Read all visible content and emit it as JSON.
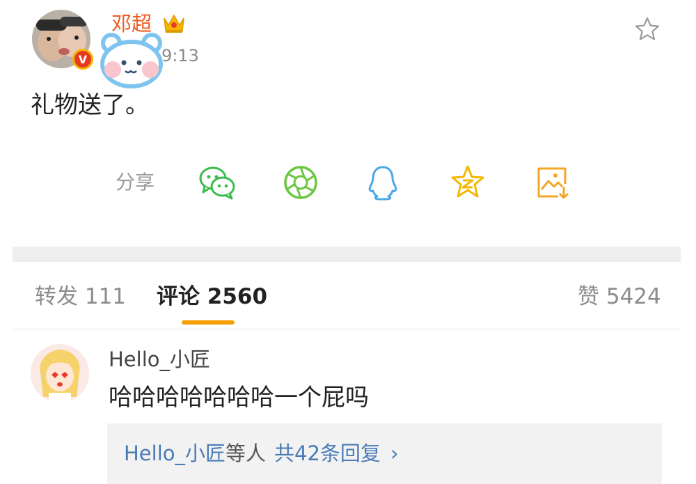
{
  "post": {
    "username": "邓超",
    "time": "9:13",
    "text": "礼物送了。",
    "verified_badge": "V"
  },
  "share": {
    "label": "分享",
    "icons": [
      "wechat-icon",
      "moments-icon",
      "qq-icon",
      "qzone-icon",
      "save-image-icon"
    ],
    "colors": {
      "wechat": "#3cbc4c",
      "moments": "#6cc644",
      "qq": "#4aa8e8",
      "qzone": "#f5b800",
      "save": "#f5a623"
    }
  },
  "tabs": {
    "repost": "转发 111",
    "comment": "评论 2560",
    "like": "赞 5424"
  },
  "comment": {
    "username": "Hello_小匠",
    "text": "哈哈哈哈哈哈哈一个屁吗",
    "reply_name": "Hello_小匠",
    "reply_mid": "等人",
    "reply_count": "共42条回复",
    "reply_chevron": "›"
  },
  "colors": {
    "accent": "#f5a000",
    "username": "#f15a22",
    "link": "#4a7bb7"
  }
}
